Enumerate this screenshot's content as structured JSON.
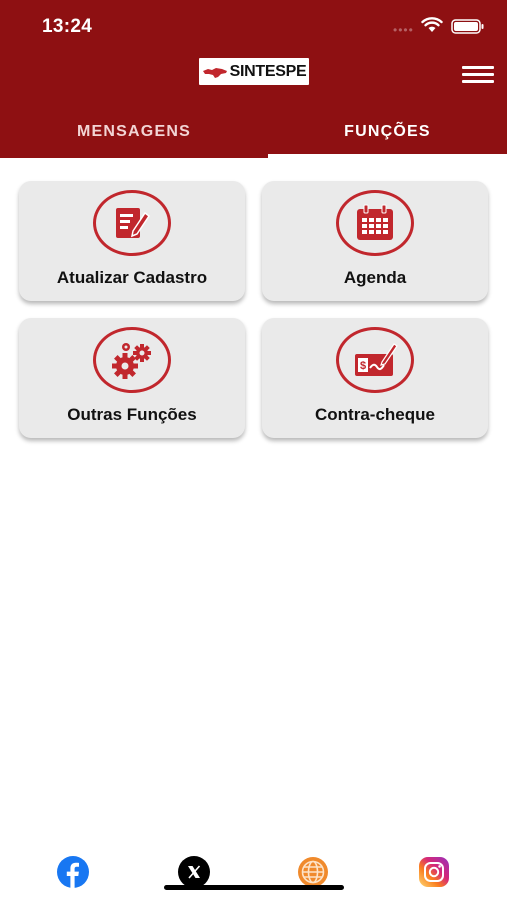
{
  "status": {
    "time": "13:24",
    "dots": "••••"
  },
  "header": {
    "logo_text": "SINTESPE",
    "logo_sup": "—"
  },
  "tabs": [
    {
      "label": "MENSAGENS",
      "active": false
    },
    {
      "label": "FUNÇÕES",
      "active": true
    }
  ],
  "functions": [
    {
      "label": "Atualizar Cadastro",
      "icon": "edit-document-icon"
    },
    {
      "label": "Agenda",
      "icon": "calendar-icon"
    },
    {
      "label": "Outras Funções",
      "icon": "gears-icon"
    },
    {
      "label": "Contra-cheque",
      "icon": "check-payment-icon"
    }
  ],
  "social": [
    {
      "name": "facebook",
      "icon": "facebook-icon"
    },
    {
      "name": "x",
      "icon": "x-icon"
    },
    {
      "name": "website",
      "icon": "globe-icon"
    },
    {
      "name": "instagram",
      "icon": "instagram-icon"
    }
  ],
  "colors": {
    "brand": "#8e1012",
    "icon_red": "#c1272d",
    "card_bg": "#eaeaea"
  }
}
